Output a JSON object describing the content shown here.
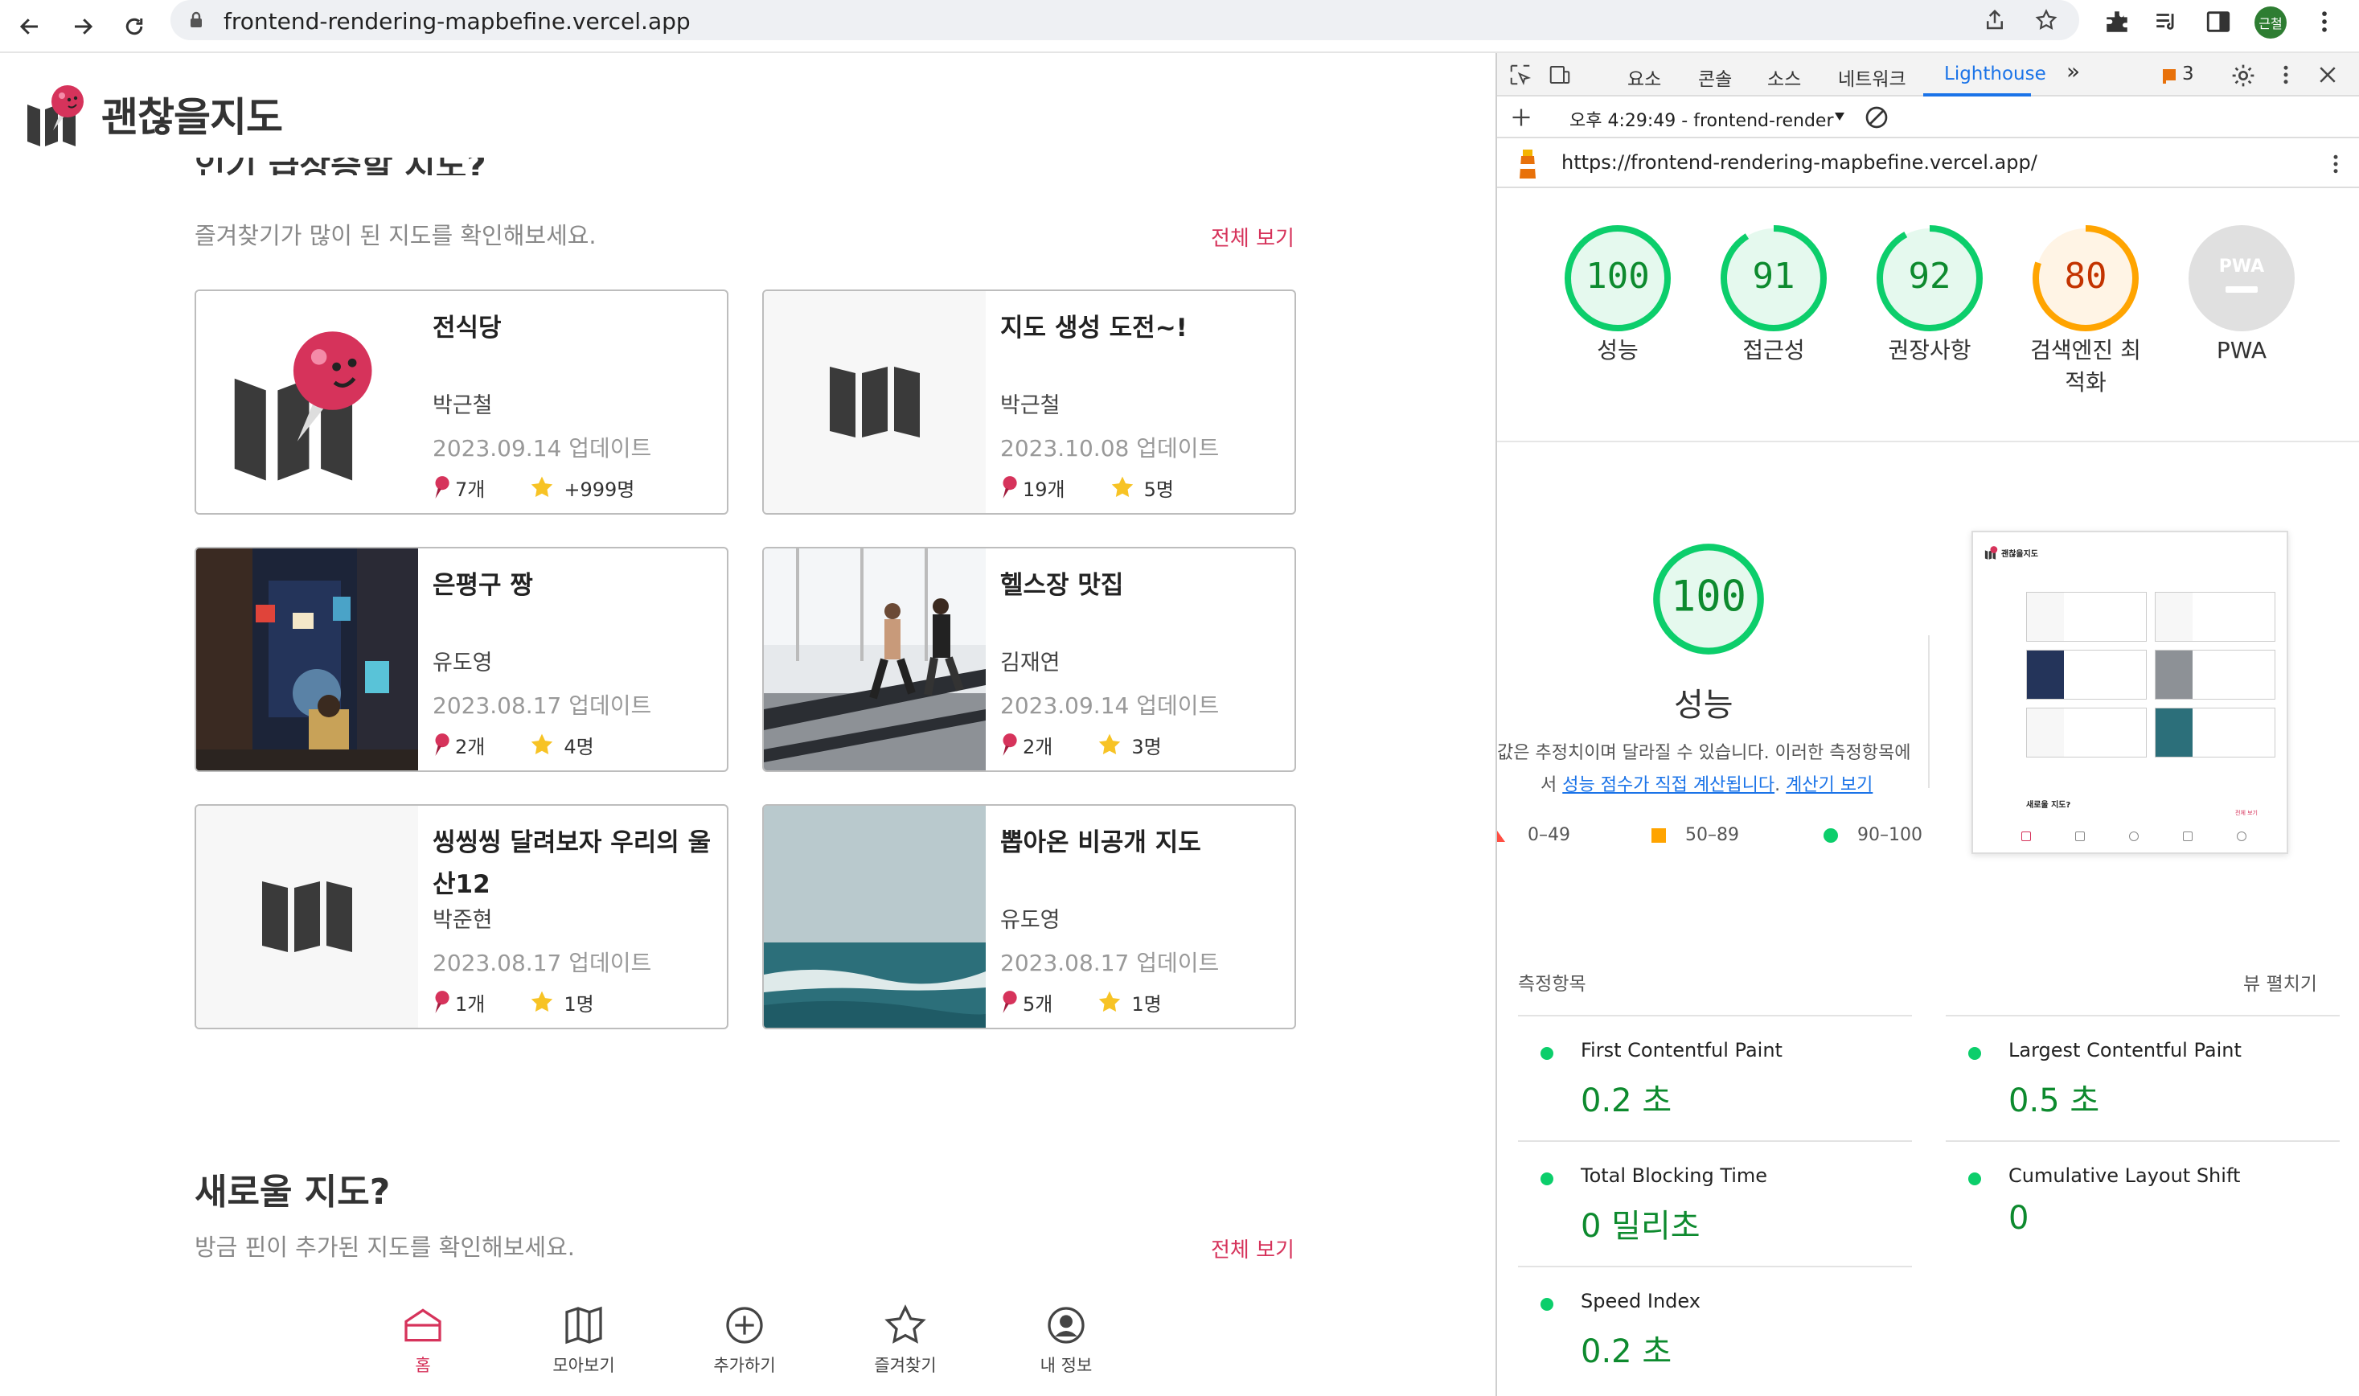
{
  "browser": {
    "url": "frontend-rendering-mapbefine.vercel.app",
    "profile_initials": "근철"
  },
  "app": {
    "logo_text": "괜찮을지도",
    "section1": {
      "title": "인기 급상승할 지도?",
      "subtitle": "즐겨찾기가 많이 된 지도를 확인해보세요.",
      "see_all": "전체 보기"
    },
    "cards": [
      {
        "title": "전식당",
        "author": "박근철",
        "updated": "2023.09.14 업데이트",
        "pins": "7개",
        "stars": "+999명",
        "thumb": "logo"
      },
      {
        "title": "지도 생성 도전~!",
        "author": "박근철",
        "updated": "2023.10.08 업데이트",
        "pins": "19개",
        "stars": "5명",
        "thumb": "map"
      },
      {
        "title": "은평구 짱",
        "author": "유도영",
        "updated": "2023.08.17 업데이트",
        "pins": "2개",
        "stars": "4명",
        "thumb": "street"
      },
      {
        "title": "헬스장 맛집",
        "author": "김재연",
        "updated": "2023.09.14 업데이트",
        "pins": "2개",
        "stars": "3명",
        "thumb": "gym"
      },
      {
        "title": "씽씽씽 달려보자 우리의 울산12",
        "author": "박준현",
        "updated": "2023.08.17 업데이트",
        "pins": "1개",
        "stars": "1명",
        "thumb": "map"
      },
      {
        "title": "뽑아온 비공개 지도",
        "author": "유도영",
        "updated": "2023.08.17 업데이트",
        "pins": "5개",
        "stars": "1명",
        "thumb": "sea"
      }
    ],
    "section2": {
      "title": "새로울 지도?",
      "subtitle": "방금 핀이 추가된 지도를 확인해보세요.",
      "see_all": "전체 보기"
    },
    "nav": [
      {
        "label": "홈",
        "icon": "home-icon",
        "active": true
      },
      {
        "label": "모아보기",
        "icon": "map-book-icon",
        "active": false
      },
      {
        "label": "추가하기",
        "icon": "plus-circle-icon",
        "active": false
      },
      {
        "label": "즐겨찾기",
        "icon": "star-outline-icon",
        "active": false
      },
      {
        "label": "내 정보",
        "icon": "user-circle-icon",
        "active": false
      }
    ],
    "accent_color": "#d6335b"
  },
  "devtools": {
    "tabs": [
      "요소",
      "콘솔",
      "소스",
      "네트워크",
      "Lighthouse"
    ],
    "active_tab": "Lighthouse",
    "more_tabs": "»",
    "issues_count": "3",
    "report_selector": "오후 4:29:49 - frontend-render",
    "report_url": "https://frontend-rendering-mapbefine.vercel.app/",
    "scores": [
      {
        "value": "100",
        "label": "성능",
        "percent": 100,
        "color": "#0cce6b"
      },
      {
        "value": "91",
        "label": "접근성",
        "percent": 91,
        "color": "#0cce6b"
      },
      {
        "value": "92",
        "label": "권장사항",
        "percent": 92,
        "color": "#0cce6b"
      },
      {
        "value": "80",
        "label": "검색엔진 최적화",
        "percent": 80,
        "color": "#ffa400"
      },
      {
        "value": "",
        "label": "PWA",
        "percent": 0,
        "color": "#cccccc"
      }
    ],
    "pwa_badge": "PWA",
    "big_score": {
      "value": "100",
      "label": "성능"
    },
    "perf_desc_line1": "값은 추정치이며 달라질 수 있습니다. 이러한 측정항목에",
    "perf_desc_line2_prefix": "서 ",
    "perf_desc_link1": "성능 점수가 직접 계산됩니다",
    "perf_desc_sep": ". ",
    "perf_desc_link2": "계산기 보기",
    "legend": [
      "0–49",
      "50–89",
      "90–100"
    ],
    "metrics_heading": "측정항목",
    "expand_view": "뷰 펼치기",
    "metrics": [
      {
        "name": "First Contentful Paint",
        "value": "0.2 초"
      },
      {
        "name": "Largest Contentful Paint",
        "value": "0.5 초"
      },
      {
        "name": "Total Blocking Time",
        "value": "0 밀리초"
      },
      {
        "name": "Cumulative Layout Shift",
        "value": "0"
      },
      {
        "name": "Speed Index",
        "value": "0.2 초"
      }
    ],
    "preview": {
      "logo_text": "괜찮을지도",
      "section_title": "새로울 지도?",
      "see_all": "전체 보기"
    }
  }
}
